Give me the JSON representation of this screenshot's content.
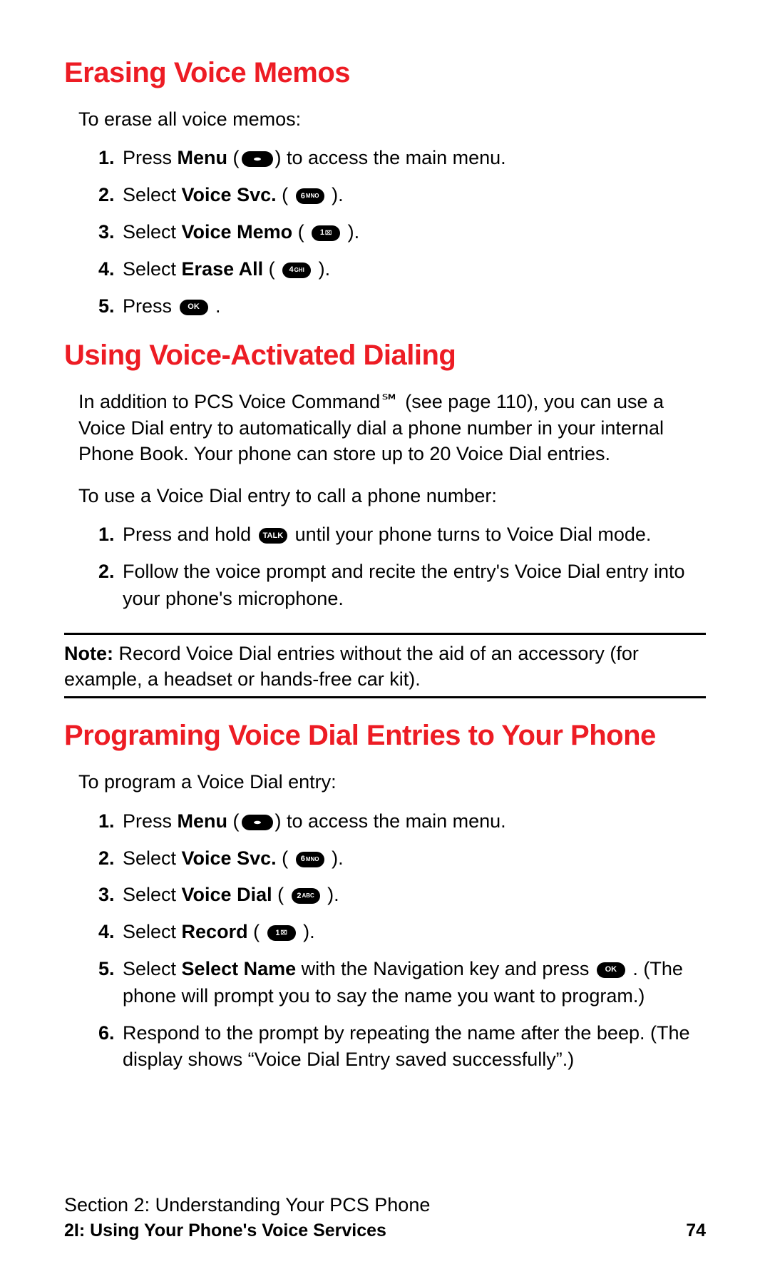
{
  "section1": {
    "heading": "Erasing Voice Memos",
    "intro": "To erase all voice memos:",
    "steps": [
      {
        "num": "1.",
        "pre": "Press ",
        "key": "NAV",
        "mid": " (",
        "bold": "Menu",
        "post": ") to access the main menu."
      },
      {
        "num": "2.",
        "pre": "Select ",
        "bold": "Voice Svc.",
        "mid": " ( ",
        "key": "6MNO",
        "post": " )."
      },
      {
        "num": "3.",
        "pre": "Select ",
        "bold": "Voice Memo",
        "mid": " ( ",
        "key": "1☒",
        "post": " )."
      },
      {
        "num": "4.",
        "pre": "Select ",
        "bold": "Erase All",
        "mid": " ( ",
        "key": "4GHI",
        "post": " )."
      },
      {
        "num": "5.",
        "pre": "Press ",
        "key": "OK",
        "post": " ."
      }
    ]
  },
  "section2": {
    "heading": "Using Voice-Activated Dialing",
    "body": "In addition to PCS Voice Command℠ (see page 110), you can use a Voice Dial entry to automatically dial a phone number in your internal Phone Book. Your phone can store up to 20 Voice Dial entries.",
    "intro": "To use a Voice Dial entry to call a phone number:",
    "steps": [
      {
        "num": "1.",
        "pre": "Press and hold ",
        "key": "TALK",
        "post": " until your phone turns to Voice Dial mode."
      },
      {
        "num": "2.",
        "text": "Follow the voice prompt and recite the entry's Voice Dial entry into your phone's microphone."
      }
    ],
    "note_label": "Note:",
    "note_text": " Record Voice Dial entries without the aid of an accessory (for example, a headset or hands-free car kit)."
  },
  "section3": {
    "heading": "Programing Voice Dial Entries to Your Phone",
    "intro": "To program a Voice Dial entry:",
    "steps": [
      {
        "num": "1.",
        "pre": "Press ",
        "key": "NAV",
        "mid": " (",
        "bold": "Menu",
        "post": ") to access the main menu."
      },
      {
        "num": "2.",
        "pre": "Select ",
        "bold": "Voice Svc.",
        "mid": " ( ",
        "key": "6MNO",
        "post": " )."
      },
      {
        "num": "3.",
        "pre": "Select ",
        "bold": "Voice Dial",
        "mid": " ( ",
        "key": "2ABC",
        "post": " )."
      },
      {
        "num": "4.",
        "pre": "Select ",
        "bold": "Record",
        "mid": " ( ",
        "key": "1☒",
        "post": " )."
      },
      {
        "num": "5.",
        "pre": "Select ",
        "bold": "Select Name",
        "mid": " with the Navigation key and press ",
        "key": "OK",
        "post": " . (The phone will prompt you to say the name you want to program.)"
      },
      {
        "num": "6.",
        "text": "Respond to the prompt by repeating the name after the beep. (The display shows “Voice Dial Entry saved successfully”.)"
      }
    ]
  },
  "footer": {
    "line1": "Section 2: Understanding Your PCS Phone",
    "line2_left": "2I: Using Your Phone's Voice Services",
    "line2_right": "74"
  },
  "keys": {
    "NAV": "",
    "6MNO": {
      "n": "6",
      "s": "MNO"
    },
    "1☒": {
      "n": "1",
      "s": "⌧"
    },
    "4GHI": {
      "n": "4",
      "s": "GHI"
    },
    "2ABC": {
      "n": "2",
      "s": "ABC"
    },
    "OK": "OK",
    "TALK": "TALK"
  }
}
